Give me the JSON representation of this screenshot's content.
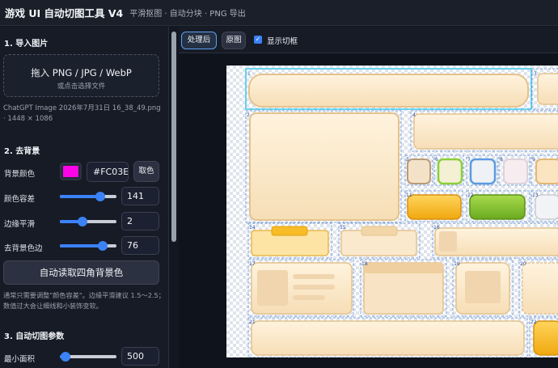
{
  "header": {
    "title": "游戏 UI 自动切图工具 V4",
    "subtitle": "平滑抠图 · 自动分块 · PNG 导出"
  },
  "import": {
    "section_title": "1. 导入图片",
    "drop_text": "拖入 PNG / JPG / WebP",
    "drop_subtext": "或点击选择文件",
    "file_info": "ChatGPT Image 2026年7月31日 16_38_49.png · 1448 × 1086"
  },
  "background": {
    "section_title": "2. 去背景",
    "color_label": "背景颜色",
    "color_value": "#FC03E8",
    "color_hex": "#fc03e8",
    "pick_button": "取色",
    "tolerance_label": "颜色容差",
    "tolerance_value": "141",
    "tolerance_fraction": 0.72,
    "smooth_label": "边缘平滑",
    "smooth_value": "2",
    "smooth_fraction": 0.4,
    "defringe_label": "去背景色边",
    "defringe_value": "76",
    "defringe_fraction": 0.76,
    "auto_button": "自动读取四角背景色",
    "hint": "通常只需要调整\"颜色容差\"。边缘平滑建议 1.5～2.5；数值过大会让细线和小装饰变软。"
  },
  "slicing": {
    "section_title": "3. 自动切图参数",
    "min_area_label": "最小面积",
    "min_area_value": "500",
    "min_area_fraction": 0.1
  },
  "toolbar": {
    "processed_label": "处理后",
    "original_label": "原图",
    "show_boxes_label": "显示切框",
    "show_boxes_checked": true
  },
  "canvas": {
    "box_labels": [
      "1",
      "2",
      "3",
      "4",
      "5",
      "6",
      "7",
      "8",
      "9",
      "10",
      "11",
      "12",
      "13",
      "14",
      "15",
      "16",
      "17",
      "18",
      "19",
      "20",
      "21",
      "22"
    ]
  },
  "colors": {
    "accent": "#3b82f6",
    "selection_box": "#3bc6e8",
    "panel_cream": "#fbe8c8",
    "panel_border": "#e8c99a",
    "yellow_button": "#f5b91e",
    "green_button": "#7cbf2c"
  }
}
